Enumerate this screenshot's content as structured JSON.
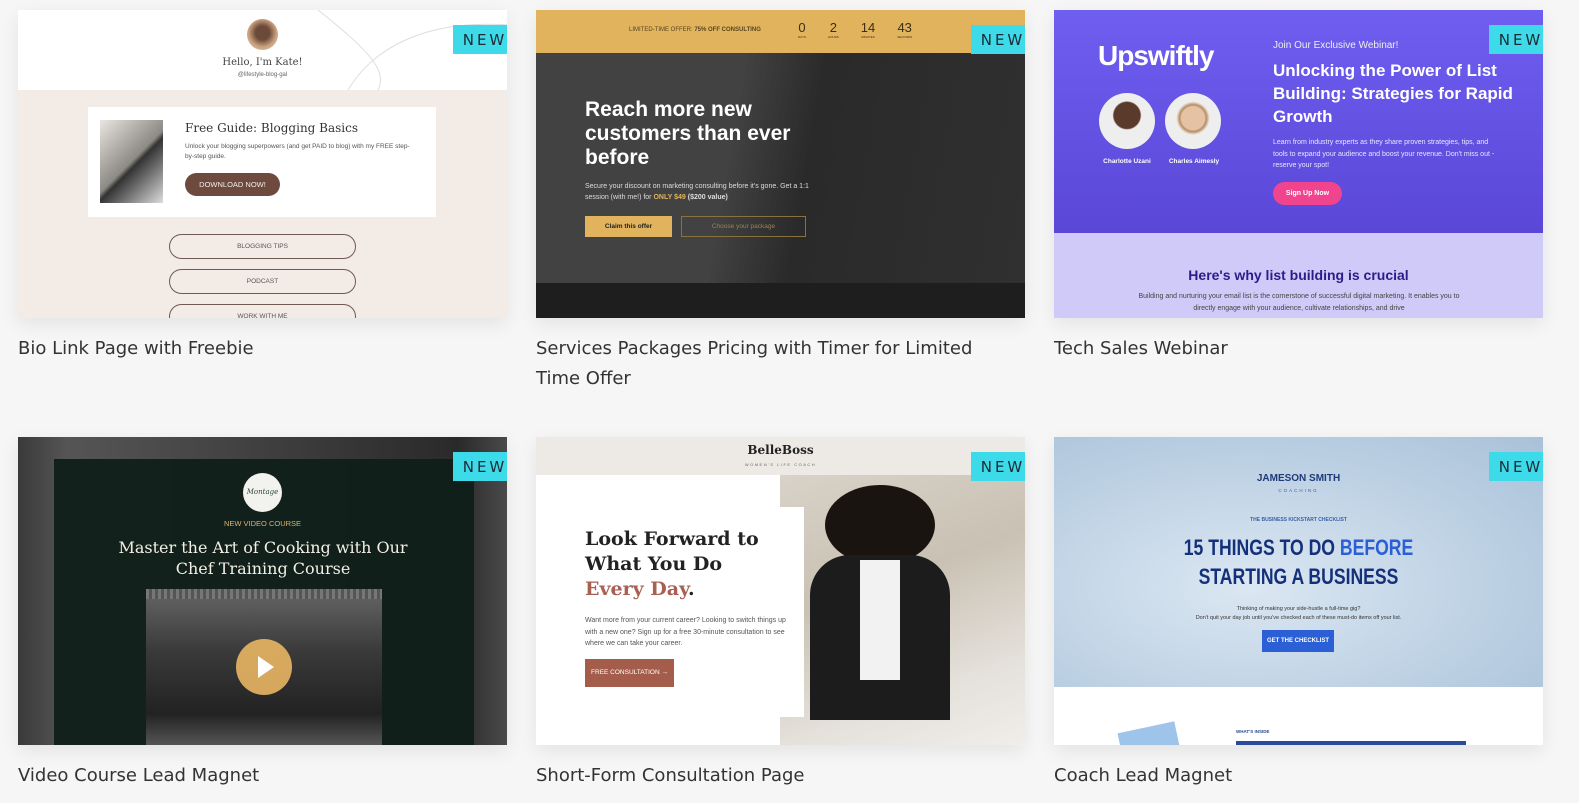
{
  "badge": "NEW",
  "cards": [
    {
      "title": "Bio Link Page with Freebie",
      "preview": {
        "greeting": "Hello, I'm Kate!",
        "handle": "@lifestyle-blog-gal",
        "guide_title": "Free Guide: Blogging Basics",
        "guide_text": "Unlock your blogging superpowers (and get PAID to blog) with my FREE step-by-step guide.",
        "download": "DOWNLOAD NOW!",
        "links": [
          "BLOGGING TIPS",
          "PODCAST",
          "WORK WITH ME"
        ]
      }
    },
    {
      "title": "Services Packages Pricing with Timer for Limited Time Offer",
      "preview": {
        "offer_prefix": "LIMITED-TIME OFFER:",
        "offer_bold": "75% OFF CONSULTING",
        "timer": [
          "0",
          "2",
          "14",
          "43"
        ],
        "timer_units": [
          "DAYS",
          "HOURS",
          "MINUTES",
          "SECONDS"
        ],
        "headline": "Reach more new customers than ever before",
        "body": "Secure your discount on marketing consulting before it's gone. Get a 1:1 session (with me!) for",
        "price": "ONLY $49",
        "value": "($200 value)",
        "claim": "Claim this offer",
        "choose": "Choose your package"
      }
    },
    {
      "title": "Tech Sales Webinar",
      "preview": {
        "logo": "Upswiftly",
        "speakers": [
          "Charlotte Uzani",
          "Charles Aimesly"
        ],
        "kicker": "Join Our Exclusive Webinar!",
        "headline": "Unlocking the Power of List Building: Strategies for Rapid Growth",
        "body": "Learn from industry experts as they share proven strategies, tips, and tools to expand your audience and boost your revenue. Don't miss out - reserve your spot!",
        "cta": "Sign Up Now",
        "section_title": "Here's why list building is crucial",
        "section_body": "Building and nurturing your email list is the cornerstone of successful digital marketing. It enables you to directly engage with your audience, cultivate relationships, and drive"
      }
    },
    {
      "title": "Video Course Lead Magnet",
      "preview": {
        "logo": "Montage",
        "kicker": "NEW VIDEO COURSE",
        "headline": "Master the Art of Cooking with Our Chef Training Course"
      }
    },
    {
      "title": "Short-Form Consultation Page",
      "preview": {
        "brand": "BelleBoss",
        "tagline": "WOMEN'S LIFE COACH",
        "headline1": "Look Forward to What You Do",
        "headline2": "Every Day",
        "period": ".",
        "body": "Want more from your current career? Looking to switch things up with a new one? Sign up for a free 30-minute consultation to see where we can take your career.",
        "cta": "FREE CONSULTATION →"
      }
    },
    {
      "title": "Coach Lead Magnet",
      "preview": {
        "brand": "JAMESON SMITH",
        "brand_sub": "COACHING",
        "kicker": "THE BUSINESS KICKSTART CHECKLIST",
        "headline1": "15 THINGS TO DO",
        "headline_accent": "BEFORE",
        "headline2": "STARTING A BUSINESS",
        "body1": "Thinking of making your side-hustle a full-time gig?",
        "body2": "Don't quit your day job until you've checked each of these must-do items off your list.",
        "cta": "GET THE CHECKLIST",
        "inside": "WHAT'S INSIDE"
      }
    }
  ]
}
